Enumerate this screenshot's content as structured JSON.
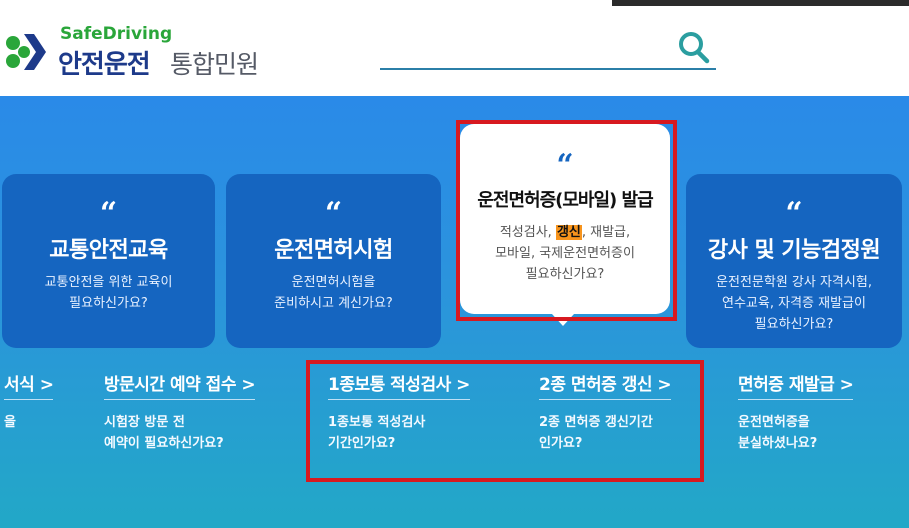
{
  "header": {
    "logo_sub": "SafeDriving",
    "logo_main": "안전운전",
    "logo_suffix": "통합민원",
    "search_placeholder": "",
    "accent": "#2b7fa8"
  },
  "cards": [
    {
      "title": "교통안전교육",
      "desc1": "교통안전을 위한 교육이",
      "desc2": "필요하신가요?"
    },
    {
      "title": "운전면허시험",
      "desc1": "운전면허시험을",
      "desc2": "준비하시고 계신가요?"
    },
    {
      "title": "운전면허증(모바일) 발급",
      "desc_a": "적성검사, ",
      "desc_hl": "갱신",
      "desc_b": ", 재발급,",
      "desc2": "모바일, 국제운전면허증이",
      "desc3": "필요하신가요?",
      "active": true
    },
    {
      "title": "강사 및 기능검정원",
      "desc1": "운전전문학원 강사 자격시험,",
      "desc2": "연수교육, 자격증 재발급이",
      "desc3": "필요하신가요?"
    }
  ],
  "quote_glyph": "“",
  "links": [
    {
      "title": "서식 >",
      "desc1": "을",
      "desc2": ""
    },
    {
      "title": "방문시간 예약 접수 >",
      "desc1": "시험장 방문 전",
      "desc2": "예약이 필요하신가요?"
    },
    {
      "title": "1종보통 적성검사 >",
      "desc1": "1종보통 적성검사",
      "desc2": "기간인가요?"
    },
    {
      "title": "2종 면허증 갱신 >",
      "desc1": "2종 면허증 갱신기간",
      "desc2": "인가요?"
    },
    {
      "title": "면허증 재발급 >",
      "desc1": "운전면허증을",
      "desc2": "분실하셨나요?"
    }
  ],
  "colors": {
    "card_blue": "#1565c0",
    "highlight": "#f7941d",
    "annotation_red": "#d71920"
  }
}
